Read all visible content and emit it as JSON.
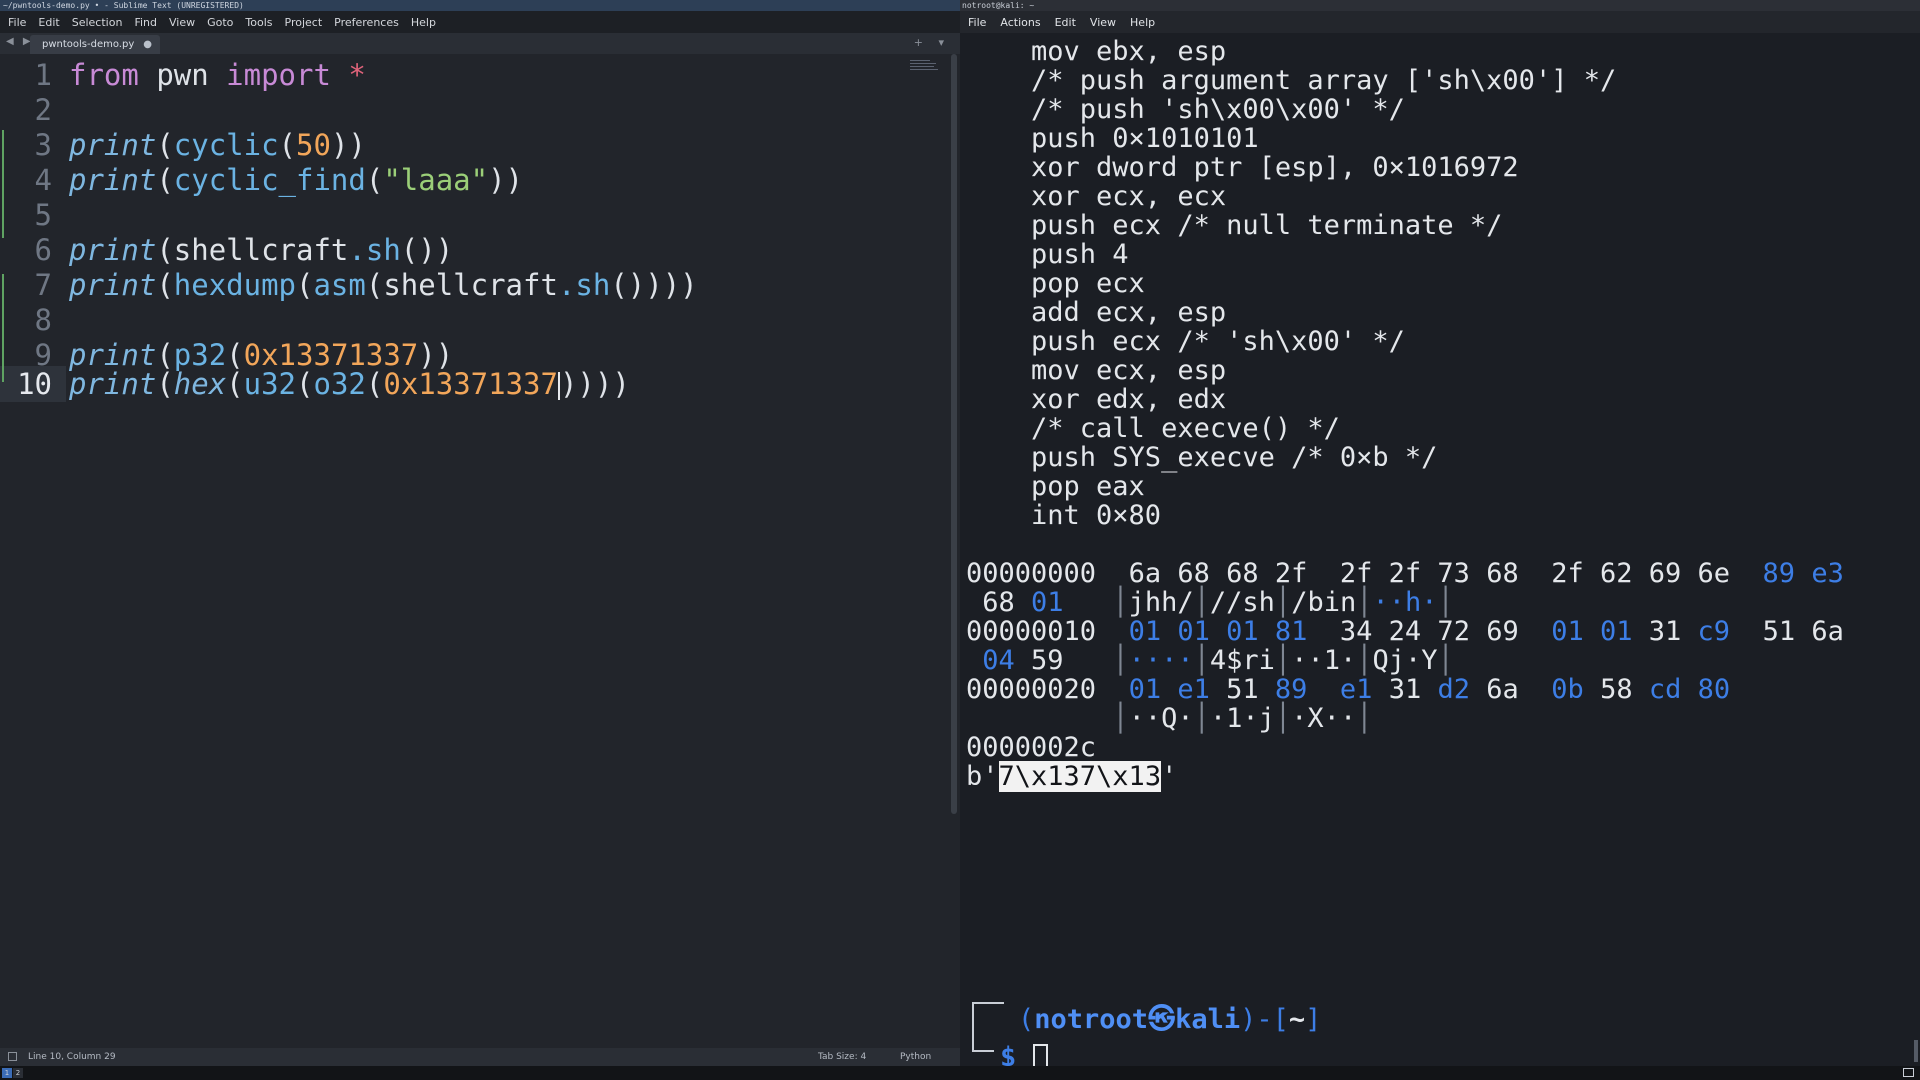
{
  "sublime": {
    "title": "~/pwntools-demo.py • - Sublime Text (UNREGISTERED)",
    "menu": [
      "File",
      "Edit",
      "Selection",
      "Find",
      "View",
      "Goto",
      "Tools",
      "Project",
      "Preferences",
      "Help"
    ],
    "tab_nav": "◀ ▶",
    "tab": {
      "name": "pwntools-demo.py",
      "modified_mark": "●"
    },
    "tab_controls": "+ ▾",
    "code": {
      "line_numbers": [
        "1",
        "2",
        "3",
        "4",
        "5",
        "6",
        "7",
        "8",
        "9",
        "10"
      ],
      "l1": {
        "kw1": "from",
        "mod": "pwn",
        "kw2": "import",
        "star": "*"
      },
      "l3": {
        "print": "print",
        "fn": "cyclic",
        "arg": "50"
      },
      "l4": {
        "print": "print",
        "fn": "cyclic_find",
        "arg": "\"laaa\""
      },
      "l6": {
        "print": "print",
        "obj": "shellcraft",
        "fn": "sh"
      },
      "l7": {
        "print": "print",
        "fn1": "hexdump",
        "fn2": "asm",
        "obj": "shellcraft",
        "fn3": "sh"
      },
      "l9": {
        "print": "print",
        "fn": "p32",
        "arg": "0x13371337"
      },
      "l10": {
        "print": "print",
        "fn1": "hex",
        "fn2": "u32",
        "fn3": "o32",
        "arg": "0x13371337"
      }
    },
    "status": {
      "position": "Line 10, Column 29",
      "tab_size": "Tab Size: 4",
      "syntax": "Python"
    }
  },
  "terminal": {
    "title": "notroot@kali: ~",
    "menu": [
      "File",
      "Actions",
      "Edit",
      "View",
      "Help"
    ],
    "asm_lines": [
      "    mov ebx, esp",
      "    /* push argument array ['sh\\x00'] */",
      "    /* push 'sh\\x00\\x00' */",
      "    push 0×1010101",
      "    xor dword ptr [esp], 0×1016972",
      "    xor ecx, ecx",
      "    push ecx /* null terminate */",
      "    push 4",
      "    pop ecx",
      "    add ecx, esp",
      "    push ecx /* 'sh\\x00' */",
      "    mov ecx, esp",
      "    xor edx, edx",
      "    /* call execve() */",
      "    push SYS_execve /* 0×b */",
      "    pop eax",
      "    int 0×80"
    ],
    "hexdump": {
      "r1": {
        "addr": "00000000",
        "g1": " 6a 68 68 2f ",
        "g2": " 2f 2f 73 68 ",
        "g3": " 2f 62 69 6e ",
        "b1": " 89",
        "b2": " e3"
      },
      "r1c": {
        "b1": " 68 ",
        "b2": "01",
        "a1": "jhh/",
        "a2": "//sh",
        "a3": "/bin",
        "a4": "··h·"
      },
      "r2": {
        "addr": "00000010",
        "b1": " 01 01 01 81",
        "g2": "  34 24 72 69 ",
        "b2": " 01 01",
        "w1": " 31",
        "b3": " c9",
        "w2": "  51 6a"
      },
      "r2c": {
        "b1": " 04",
        "w1": " 59 ",
        "a1": "····",
        "a2": "4$ri",
        "a3": "··1·",
        "a4": "Qj·Y"
      },
      "r3": {
        "addr": "00000020",
        "b1": " 01 e1",
        "w1": " 51",
        "b2": " 89 ",
        "b3": " e1",
        "w2": " 31",
        "b4": " d2",
        "w3": " 6a ",
        "b5": " 0b",
        "w4": " 58",
        "b6": " cd 80"
      },
      "r3c": {
        "a1": "··Q·",
        "a2": "·1·j",
        "a3": "·X··"
      },
      "end": "0000002c"
    },
    "bytes_output": {
      "prefix": "b'",
      "selected": "7\\x137\\x13",
      "suffix": "'"
    },
    "prompt": {
      "user": "notroot",
      "host": "kali",
      "dir": "~",
      "symbol": "$"
    }
  },
  "taskbar": {
    "workspaces": [
      "1",
      "2"
    ]
  }
}
